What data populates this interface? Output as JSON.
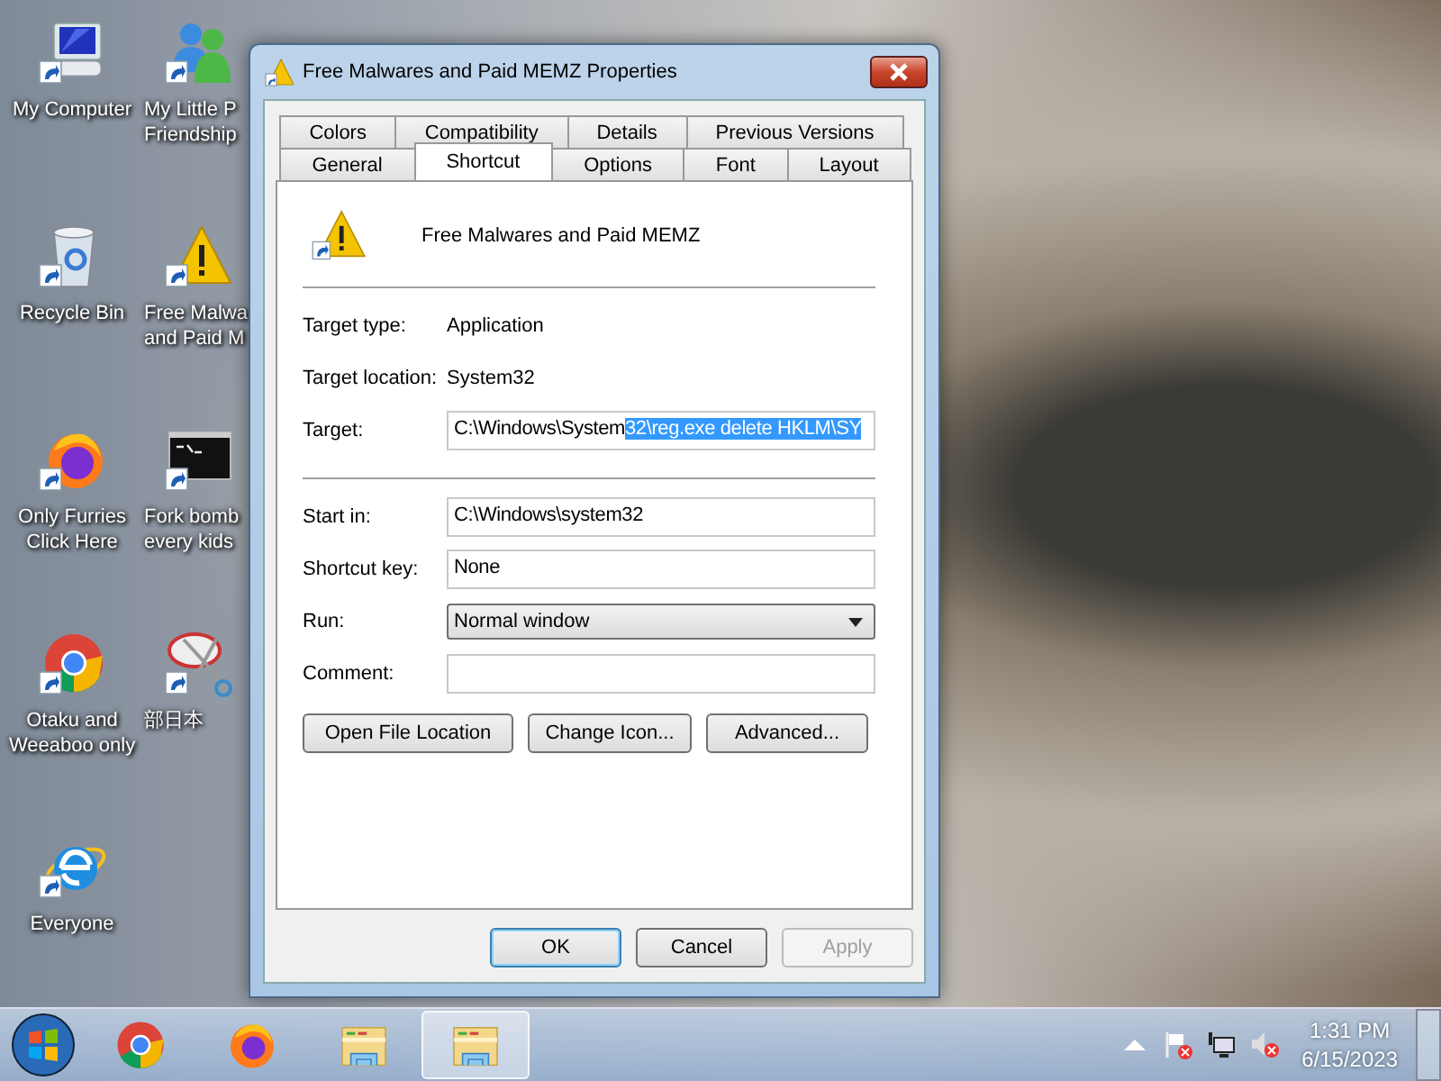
{
  "desktop_icons": [
    {
      "kind": "computer",
      "lines": [
        "My Computer"
      ]
    },
    {
      "kind": "recycle-bin",
      "lines": [
        "Recycle Bin"
      ]
    },
    {
      "kind": "firefox",
      "lines": [
        "Only Furries",
        "Click Here"
      ]
    },
    {
      "kind": "chrome",
      "lines": [
        "Otaku and",
        "Weeaboo only"
      ]
    },
    {
      "kind": "ie",
      "lines": [
        "Everyone"
      ]
    },
    {
      "kind": "people",
      "lines": [
        "My Little P",
        "Friendship"
      ]
    },
    {
      "kind": "warning",
      "lines": [
        "Free Malwa",
        "and Paid M"
      ]
    },
    {
      "kind": "console",
      "lines": [
        "Fork bomb",
        "every kids"
      ]
    },
    {
      "kind": "scissors",
      "lines": [
        "部日本"
      ]
    }
  ],
  "window": {
    "title": "Free Malwares and Paid MEMZ Properties",
    "tab_rows": [
      [
        {
          "label": "Colors",
          "selected": false
        },
        {
          "label": "Compatibility",
          "selected": false
        },
        {
          "label": "Details",
          "selected": false
        },
        {
          "label": "Previous Versions",
          "selected": false
        }
      ],
      [
        {
          "label": "General",
          "selected": false
        },
        {
          "label": "Shortcut",
          "selected": true
        },
        {
          "label": "Options",
          "selected": false
        },
        {
          "label": "Font",
          "selected": false
        },
        {
          "label": "Layout",
          "selected": false
        }
      ]
    ],
    "shortcut_name": "Free Malwares and Paid MEMZ",
    "info_rows": [
      {
        "label": "Target type:",
        "value": "Application"
      },
      {
        "label": "Target location:",
        "value": "System32"
      }
    ],
    "target": {
      "label": "Target:",
      "parts": [
        {
          "text": "C:\\Windows\\System",
          "highlighted": false
        },
        {
          "text": "32\\reg.exe delete HKLM\\SY",
          "highlighted": true
        }
      ]
    },
    "fields": [
      {
        "kind": "field",
        "label": "Start in:",
        "value": "C:\\Windows\\system32"
      },
      {
        "kind": "field",
        "label": "Shortcut key:",
        "value": "None"
      },
      {
        "kind": "dropdown",
        "label": "Run:",
        "value": "Normal window"
      },
      {
        "kind": "field",
        "label": "Comment:"
      }
    ],
    "action_buttons": [
      "Open File Location",
      "Change Icon...",
      "Advanced..."
    ],
    "dialog_buttons": [
      {
        "label": "OK",
        "default": true,
        "disabled": false
      },
      {
        "label": "Cancel",
        "default": false,
        "disabled": false
      },
      {
        "label": "Apply",
        "default": false,
        "disabled": true
      }
    ]
  },
  "taskbar": {
    "items": [
      {
        "kind": "chrome",
        "active": false
      },
      {
        "kind": "firefox",
        "active": false
      },
      {
        "kind": "explorer",
        "active": false
      },
      {
        "kind": "explorer",
        "active": true
      }
    ],
    "tray": {
      "time": "1:31 PM",
      "date": "6/15/2023"
    }
  }
}
